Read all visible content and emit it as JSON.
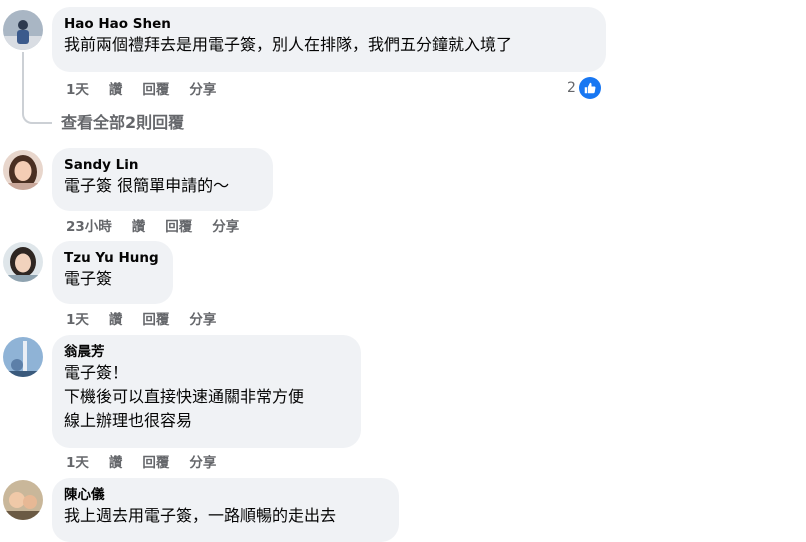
{
  "colors": {
    "bubble_bg": "#f0f2f5",
    "meta_text": "#65676b",
    "like_blue": "#1877f2"
  },
  "comments": [
    {
      "author": "Hao Hao Shen",
      "lines": [
        "我前兩個禮拜去是用電子簽，別人在排隊，我們五分鐘就入境了"
      ],
      "time": "1天",
      "like_label": "讚",
      "reply_label": "回覆",
      "share_label": "分享",
      "reaction_count": "2",
      "reaction_icon": "like-icon",
      "view_replies": "查看全部2則回覆"
    },
    {
      "author": "Sandy Lin",
      "lines": [
        "電子簽 很簡單申請的～"
      ],
      "time": "23小時",
      "like_label": "讚",
      "reply_label": "回覆",
      "share_label": "分享"
    },
    {
      "author": "Tzu Yu Hung",
      "lines": [
        "電子簽"
      ],
      "time": "1天",
      "like_label": "讚",
      "reply_label": "回覆",
      "share_label": "分享"
    },
    {
      "author": "翁晨芳",
      "lines": [
        "電子簽！",
        "下機後可以直接快速通關非常方便",
        "線上辦理也很容易"
      ],
      "time": "1天",
      "like_label": "讚",
      "reply_label": "回覆",
      "share_label": "分享"
    },
    {
      "author": "陳心儀",
      "lines": [
        "我上週去用電子簽，一路順暢的走出去"
      ]
    }
  ]
}
